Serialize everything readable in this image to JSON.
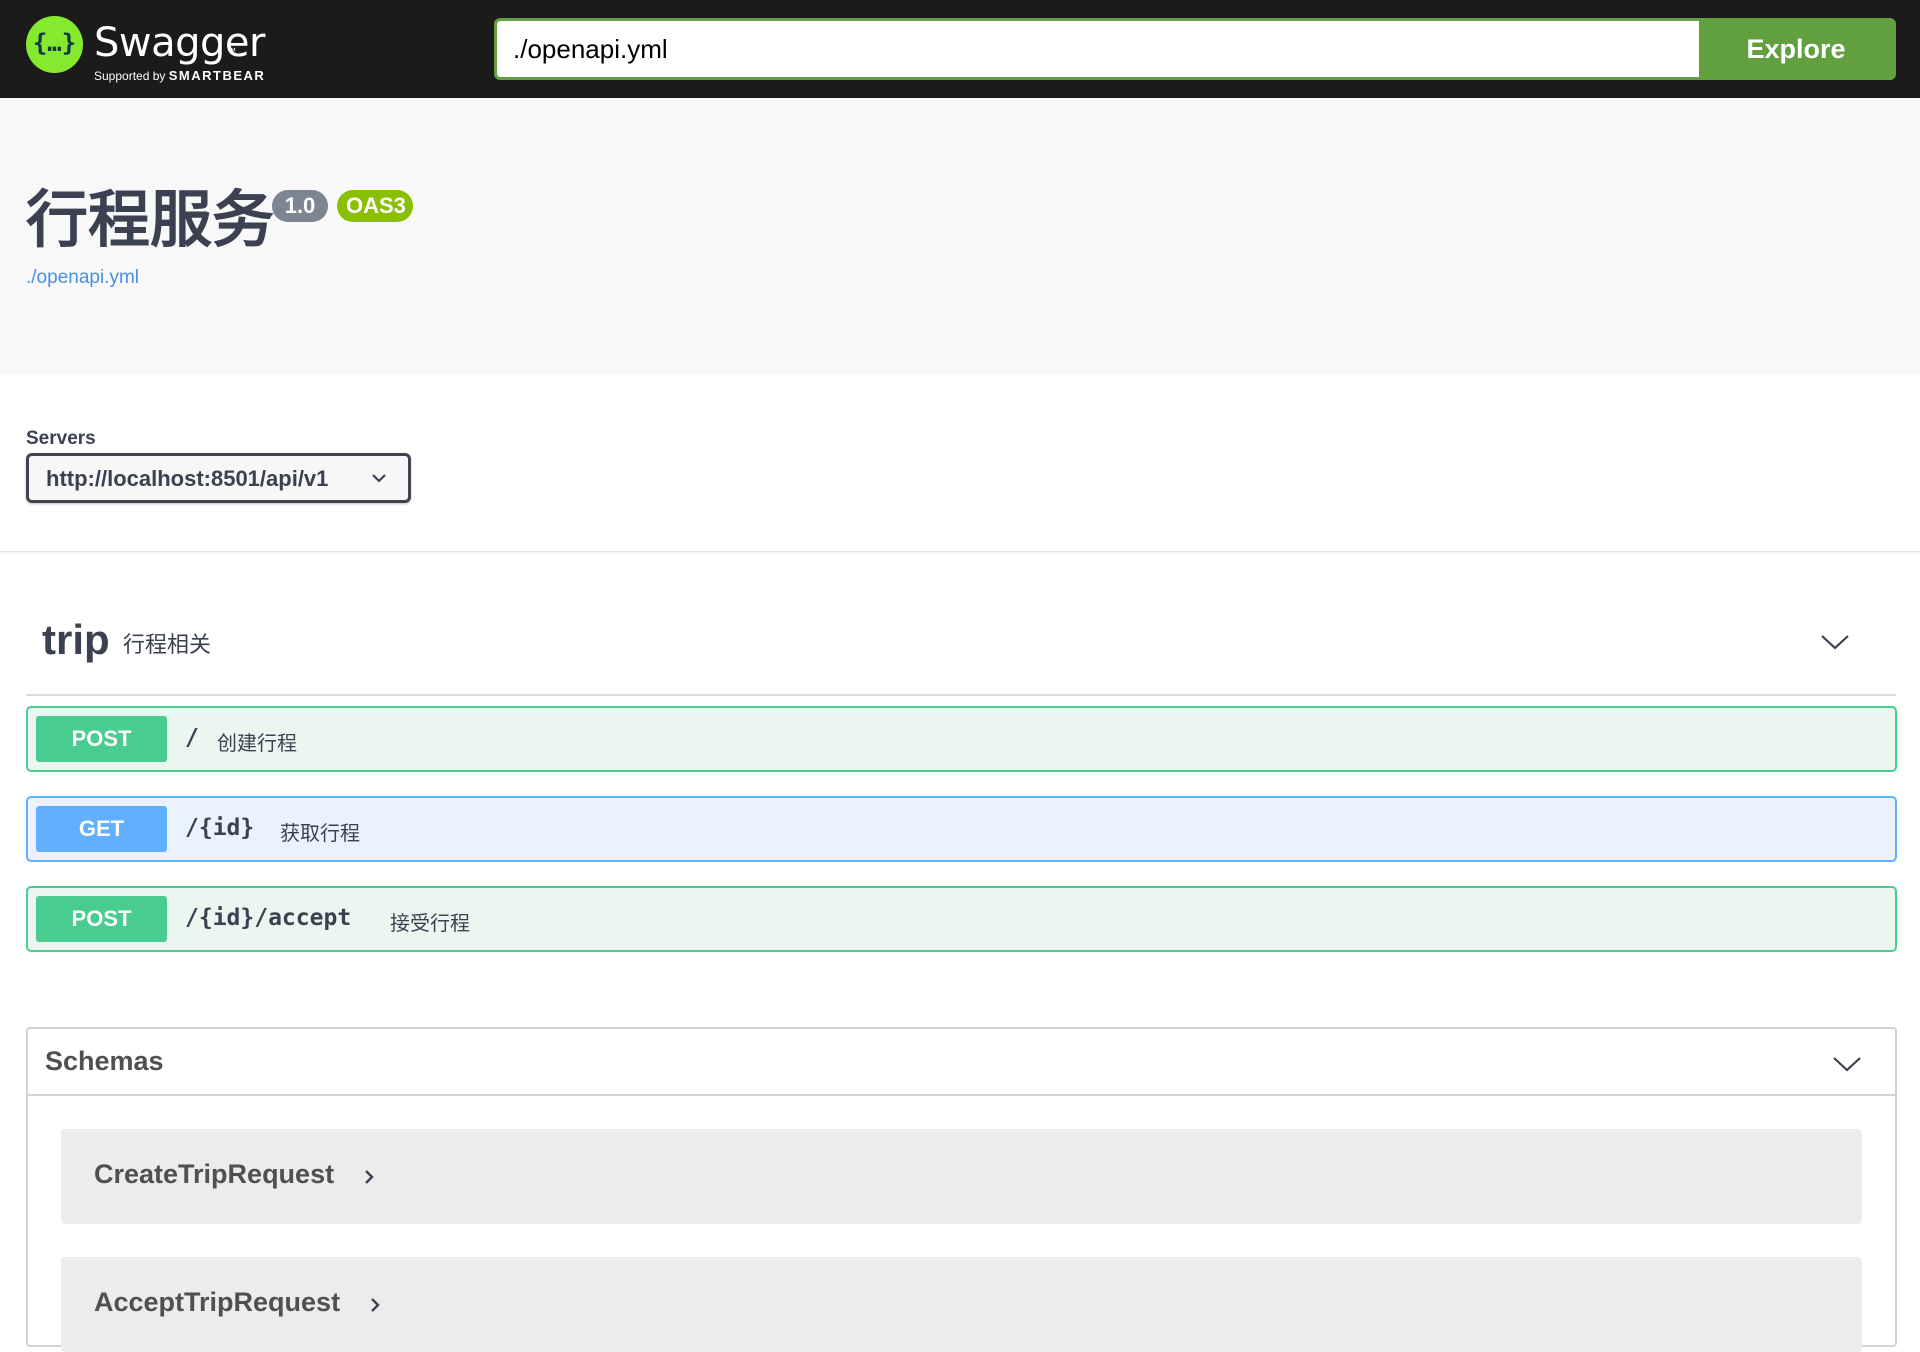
{
  "topbar": {
    "logo_glyph": "{…}",
    "brand": "Swagger",
    "brand_tm": "™",
    "supported_by": "Supported by",
    "company": "SMARTBEAR",
    "url_value": "./openapi.yml",
    "explore_label": "Explore"
  },
  "info": {
    "title": "行程服务",
    "version": "1.0",
    "oas": "OAS3",
    "spec_link": "./openapi.yml"
  },
  "servers": {
    "label": "Servers",
    "selected": "http://localhost:8501/api/v1"
  },
  "tag": {
    "name": "trip",
    "description": "行程相关"
  },
  "operations": [
    {
      "method": "POST",
      "path": "/",
      "summary": "创建行程"
    },
    {
      "method": "GET",
      "path": "/{id}",
      "summary": "获取行程"
    },
    {
      "method": "POST",
      "path": "/{id}/accept",
      "summary": "接受行程"
    }
  ],
  "schemas": {
    "title": "Schemas",
    "models": [
      "CreateTripRequest",
      "AcceptTripRequest"
    ]
  },
  "colors": {
    "post": "#49cc90",
    "get": "#61affe",
    "explore": "#62a03f",
    "logo": "#85ea2d",
    "oas_badge": "#89bf04",
    "version_badge": "#7d8492",
    "link": "#4990e2"
  },
  "icons": [
    "swagger-logo-icon",
    "chevron-down-icon",
    "chevron-right-icon"
  ]
}
